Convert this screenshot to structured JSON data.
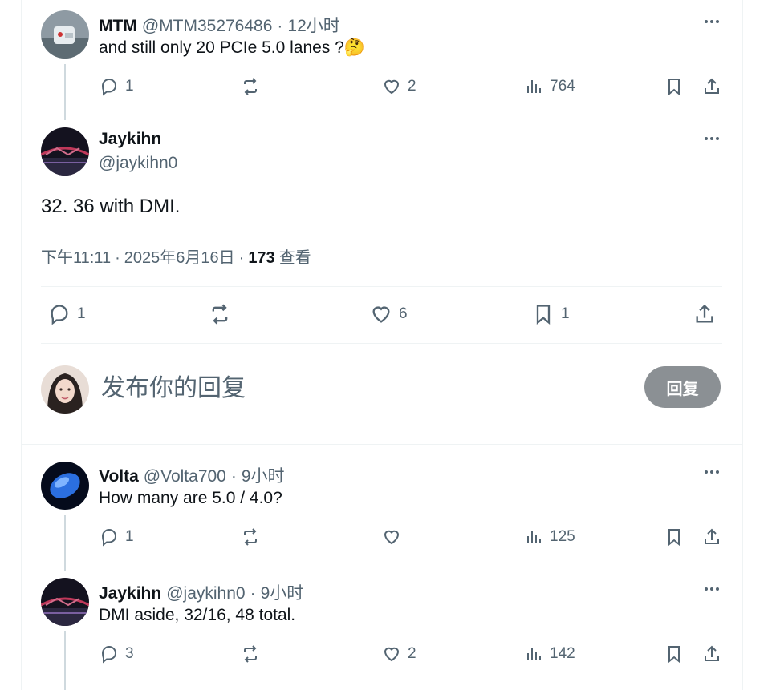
{
  "reply1": {
    "name": "MTM",
    "handle": "@MTM35276486",
    "time": "12小时",
    "text": "and still only 20 PCIe 5.0 lanes ?🤔",
    "replies": "1",
    "retweets": "",
    "likes": "2",
    "views": "764"
  },
  "main_tweet": {
    "name": "Jaykihn",
    "handle": "@jaykihn0",
    "text": "32. 36 with DMI.",
    "time": "下午11:11",
    "date": "2025年6月16日",
    "views_count": "173",
    "views_label": "查看",
    "replies": "1",
    "retweets": "",
    "likes": "6",
    "bookmarks": "1"
  },
  "composer": {
    "placeholder": "发布你的回复",
    "button_label": "回复"
  },
  "reply2": {
    "name": "Volta",
    "handle": "@Volta700",
    "time": "9小时",
    "text": "How many are 5.0 / 4.0?",
    "replies": "1",
    "retweets": "",
    "likes": "",
    "views": "125"
  },
  "reply3": {
    "name": "Jaykihn",
    "handle": "@jaykihn0",
    "time": "9小时",
    "text": "DMI aside, 32/16, 48 total.",
    "replies": "3",
    "retweets": "",
    "likes": "2",
    "views": "142"
  },
  "separator": "·",
  "colors": {
    "text": "#0f1419",
    "secondary": "#536471",
    "border": "#eff3f4",
    "button": "#8b9094"
  }
}
